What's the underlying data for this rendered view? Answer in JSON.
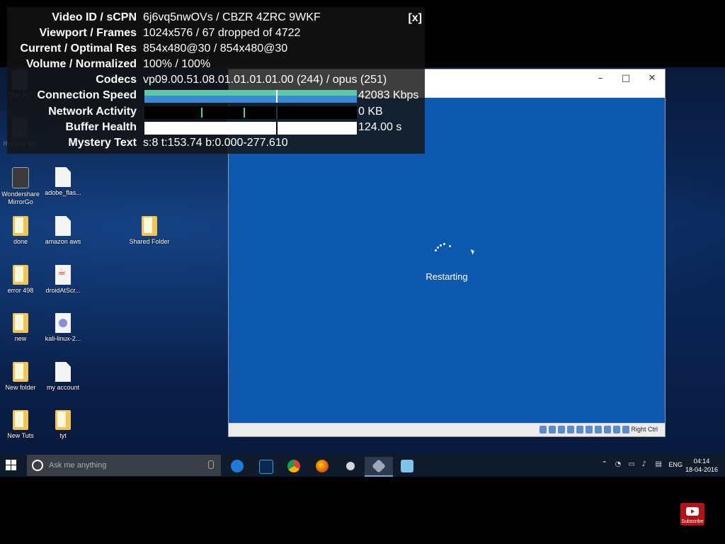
{
  "stats": {
    "close_label": "[x]",
    "rows": [
      {
        "key": "Video ID / sCPN",
        "value": "6j6vq5nwOVs / CBZR 4ZRC 9WKF"
      },
      {
        "key": "Viewport / Frames",
        "value": "1024x576 / 67 dropped of 4722"
      },
      {
        "key": "Current / Optimal Res",
        "value": "854x480@30 / 854x480@30"
      },
      {
        "key": "Volume / Normalized",
        "value": "100% / 100%"
      },
      {
        "key": "Codecs",
        "value": "vp09.00.51.08.01.01.01.01.00 (244) / opus (251)"
      },
      {
        "key": "Connection Speed",
        "value": "42083 Kbps"
      },
      {
        "key": "Network Activity",
        "value": "0 KB"
      },
      {
        "key": "Buffer Health",
        "value": "124.00 s"
      },
      {
        "key": "Mystery Text",
        "value": "s:8 t:153.74 b:0.000-277.610"
      }
    ],
    "connection_speed_color": "#3a8ad6",
    "connection_speed_accent": "#5fc9a9",
    "buffer_health_color": "#ffffff"
  },
  "desktop": {
    "icons": [
      {
        "label": "This PC",
        "icon": "pc-icon"
      },
      {
        "label": "Recycle Bin",
        "icon": "recycle-bin-icon"
      },
      {
        "label": "Wondershare MirrorGo",
        "icon": "app-icon"
      },
      {
        "label": "adobe_flas...",
        "icon": "file-icon"
      },
      {
        "label": "done",
        "icon": "folder-icon"
      },
      {
        "label": "amazon aws",
        "icon": "file-icon"
      },
      {
        "label": "Shared Folder",
        "icon": "folder-icon"
      },
      {
        "label": "error 498",
        "icon": "folder-icon"
      },
      {
        "label": "droidAtScr...",
        "icon": "java-icon"
      },
      {
        "label": "new",
        "icon": "folder-icon"
      },
      {
        "label": "kali-linux-2...",
        "icon": "iso-icon"
      },
      {
        "label": "New folder",
        "icon": "folder-icon"
      },
      {
        "label": "my account",
        "icon": "file-icon"
      },
      {
        "label": "New Tuts",
        "icon": "folder-icon"
      },
      {
        "label": "tyt",
        "icon": "folder-icon"
      }
    ]
  },
  "vm": {
    "restarting_label": "Restarting",
    "host_key": "Right Ctrl",
    "screen_color": "#0e59b0"
  },
  "taskbar": {
    "search_placeholder": "Ask me anything",
    "apps": [
      "edge-icon",
      "photoshop-icon",
      "chrome-icon",
      "firefox-icon",
      "obs-icon",
      "virtualbox-icon",
      "notes-icon"
    ],
    "language": "ENG",
    "time": "04:14",
    "date": "18-04-2016"
  },
  "watermark": {
    "subscribe_label": "Subscribe"
  }
}
